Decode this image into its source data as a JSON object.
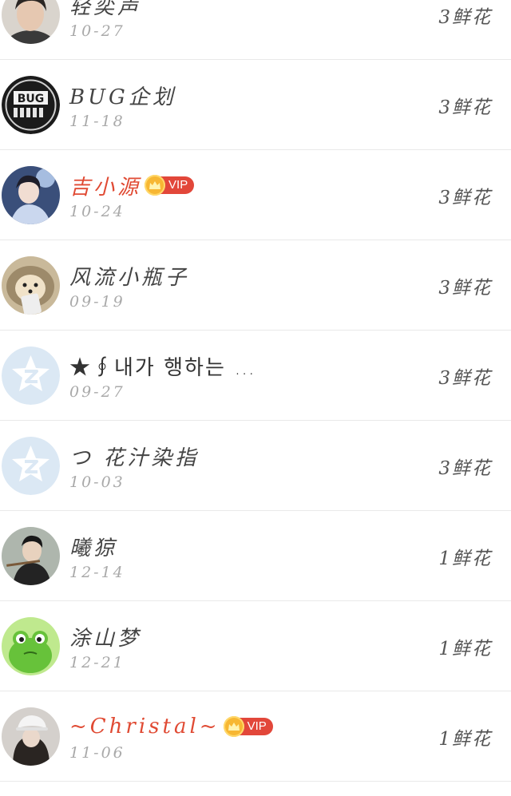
{
  "rows": [
    {
      "name": "轻奕声",
      "date": "10-27",
      "flowers": "3鲜花",
      "vip": false,
      "avatar": "portrait-young-man"
    },
    {
      "name": "BUG企划",
      "date": "11-18",
      "flowers": "3鲜花",
      "vip": false,
      "avatar": "bug-logo"
    },
    {
      "name": "吉小源",
      "date": "10-24",
      "flowers": "3鲜花",
      "vip": true,
      "avatar": "portrait-blue-dress"
    },
    {
      "name": "风流小瓶子",
      "date": "09-19",
      "flowers": "3鲜花",
      "vip": false,
      "avatar": "hedgehog"
    },
    {
      "name": "★∮내가 행하는 …",
      "date": "09-27",
      "flowers": "3鲜花",
      "vip": false,
      "avatar": "default-star"
    },
    {
      "name": "つ 花汁染指",
      "date": "10-03",
      "flowers": "3鲜花",
      "vip": false,
      "avatar": "default-star"
    },
    {
      "name": "曦猄",
      "date": "12-14",
      "flowers": "1鲜花",
      "vip": false,
      "avatar": "flute-player"
    },
    {
      "name": "涂山梦",
      "date": "12-21",
      "flowers": "1鲜花",
      "vip": false,
      "avatar": "frog"
    },
    {
      "name": "~Christal~",
      "date": "11-06",
      "flowers": "1鲜花",
      "vip": true,
      "avatar": "girl-white-cap"
    }
  ],
  "vip_label": "VIP",
  "colors": {
    "vip_name": "#e04a33",
    "vip_badge": "#e2473a",
    "crown": "#f7b733",
    "default_avatar": "#dbe8f4"
  }
}
